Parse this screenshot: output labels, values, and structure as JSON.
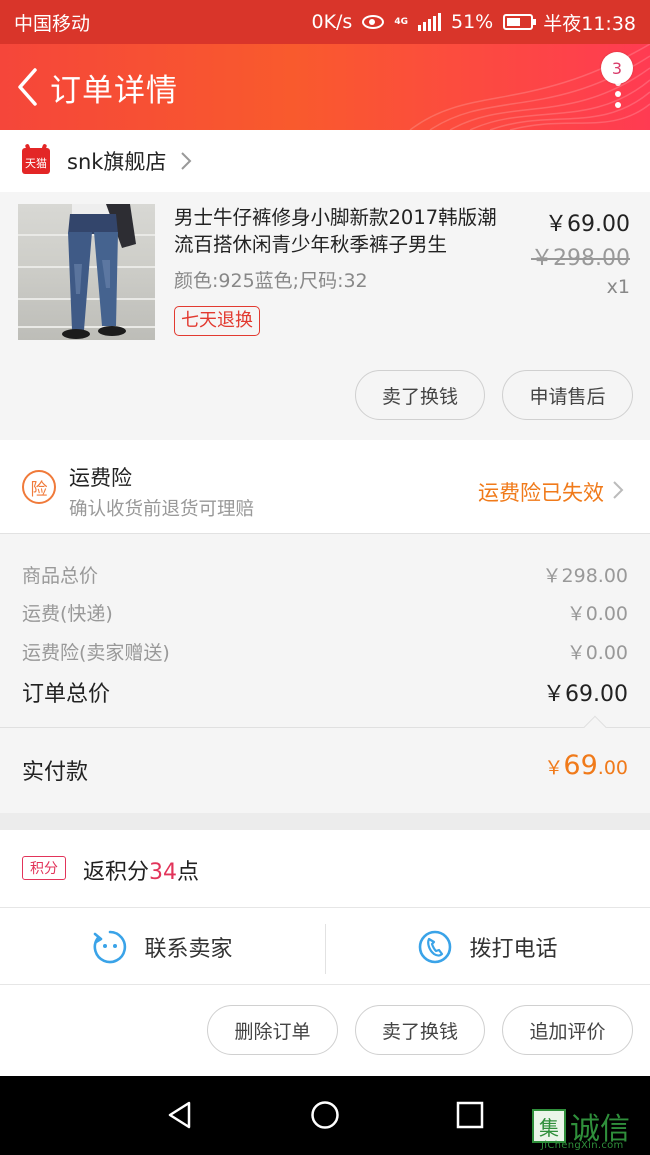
{
  "status_bar": {
    "carrier": "中国移动",
    "speed": "0K/s",
    "network": "4G",
    "battery": "51%",
    "time": "半夜11:38"
  },
  "nav": {
    "title": "订单详情",
    "badge_count": "3"
  },
  "shop": {
    "badge_label": "天猫",
    "name": "snk旗舰店"
  },
  "product": {
    "title": "男士牛仔裤修身小脚新款2017韩版潮流百搭休闲青少年秋季裤子男生",
    "spec": "颜色:925蓝色;尺码:32",
    "tag": "七天退换",
    "price": "￥69.00",
    "original_price": "￥298.00",
    "quantity": "x1",
    "buttons": [
      "卖了换钱",
      "申请售后"
    ]
  },
  "insurance": {
    "icon_label": "险",
    "title": "运费险",
    "subtitle": "确认收货前退货可理赔",
    "status": "运费险已失效"
  },
  "summary": {
    "rows": [
      {
        "label": "商品总价",
        "value": "￥298.00"
      },
      {
        "label": "运费(快递)",
        "value": "￥0.00"
      },
      {
        "label": "运费险(卖家赠送)",
        "value": "￥0.00"
      }
    ],
    "total_label": "订单总价",
    "total_value": "￥69.00",
    "paid_label": "实付款",
    "paid_currency": "￥",
    "paid_int": "69",
    "paid_dec": ".00"
  },
  "points": {
    "icon_label": "积分",
    "prefix": "返积分",
    "amount": "34",
    "suffix": "点"
  },
  "contact": {
    "seller": "联系卖家",
    "phone": "拨打电话"
  },
  "actions": [
    "删除订单",
    "卖了换钱",
    "追加评价"
  ],
  "watermark": {
    "logo": "集",
    "text": "诚信",
    "sub": "JiChengXin.com"
  },
  "colors": {
    "brand_red": "#d9352a",
    "accent_orange": "#f07a1a",
    "points_pink": "#e2345a",
    "contact_blue": "#3aa3e8"
  }
}
